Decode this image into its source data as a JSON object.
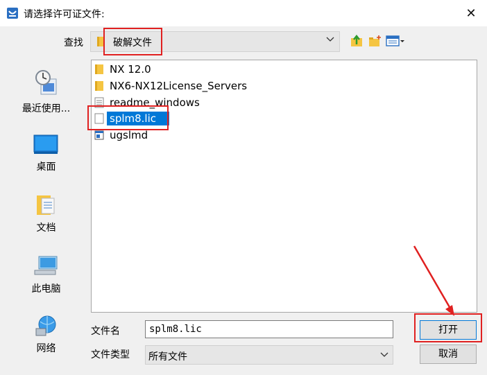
{
  "dialog": {
    "title": "请选择许可证文件:",
    "close_glyph": "✕"
  },
  "lookin": {
    "label": "查找",
    "value": "破解文件"
  },
  "places": [
    {
      "label": "最近使用...",
      "icon": "recent-icon"
    },
    {
      "label": "桌面",
      "icon": "desktop-icon"
    },
    {
      "label": "文档",
      "icon": "documents-icon"
    },
    {
      "label": "此电脑",
      "icon": "computer-icon"
    },
    {
      "label": "网络",
      "icon": "network-icon"
    }
  ],
  "files": [
    {
      "name": "NX 12.0",
      "icon": "folder-icon"
    },
    {
      "name": "NX6-NX12License_Servers",
      "icon": "folder-icon"
    },
    {
      "name": "readme_windows",
      "icon": "text-file-icon"
    },
    {
      "name": "splm8.lic",
      "icon": "file-icon",
      "selected": true
    },
    {
      "name": "ugslmd",
      "icon": "app-file-icon"
    }
  ],
  "filename": {
    "label": "文件名",
    "value": "splm8.lic"
  },
  "filetype": {
    "label": "文件类型",
    "value": "所有文件"
  },
  "buttons": {
    "open": "打开",
    "cancel": "取消"
  },
  "colors": {
    "highlight": "#e02020",
    "selection": "#0078d7"
  }
}
